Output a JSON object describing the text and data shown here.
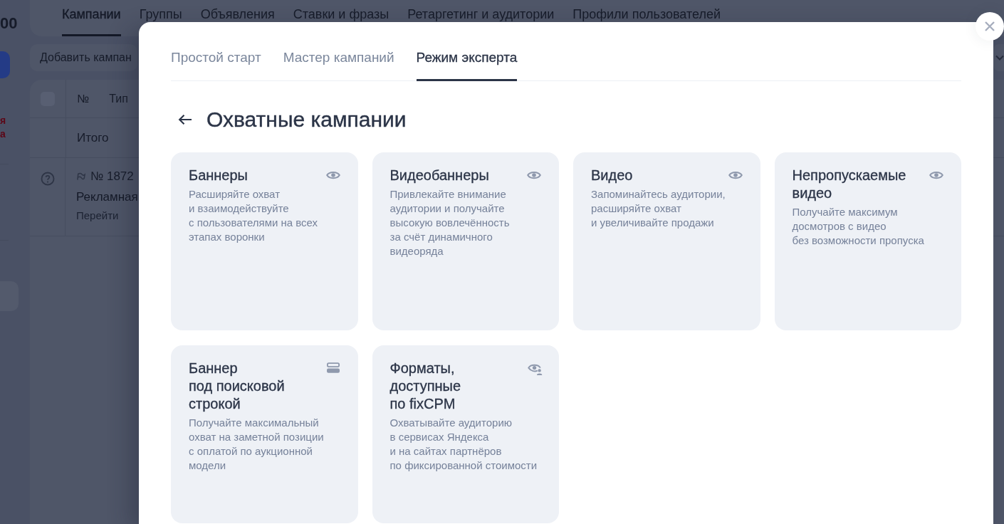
{
  "background_page": {
    "balance": "00",
    "notices": [
      "я",
      "а"
    ],
    "tabs": [
      {
        "label": "Кампании",
        "selected": true
      },
      {
        "label": "Группы",
        "selected": false
      },
      {
        "label": "Объявления",
        "selected": false
      },
      {
        "label": "Ставки и фразы",
        "selected": false
      },
      {
        "label": "Ретаргетинг и аудитории",
        "selected": false
      },
      {
        "label": "Профили пользователей",
        "selected": false
      }
    ],
    "add_button": "Добавить кампан",
    "table": {
      "select_all": {
        "checked": false
      },
      "columns": [
        "№",
        "Тип"
      ],
      "total_label": "Итого",
      "rows": [
        {
          "number": "№ 1872",
          "name": "Рекламная",
          "link": "Перейти"
        }
      ]
    }
  },
  "modal": {
    "tabs": [
      {
        "label": "Простой старт",
        "selected": false
      },
      {
        "label": "Мастер кампаний",
        "selected": false
      },
      {
        "label": "Режим эксперта",
        "selected": true
      }
    ],
    "title": "Охватные кампании",
    "cards": [
      {
        "kind": "format",
        "title": "Баннеры",
        "description": "Расширяйте охват\nи взаимодействуйте\nс пользователями на всех\nэтапах воронки"
      },
      {
        "kind": "format",
        "title": "Видеобаннеры",
        "description": "Привлекайте внимание\nаудитории и получайте\nвысокую вовлечённость\nза счёт динамичного\nвидеоряда"
      },
      {
        "kind": "format",
        "title": "Видео",
        "description": "Запоминайтесь аудитории,\nрасширяйте охват\nи увеличивайте продажи"
      },
      {
        "kind": "format",
        "title": "Непропускаемые\nвидео",
        "description": "Получайте максимум\nдосмотров с видео\nбез возможности пропуска"
      },
      {
        "kind": "searchbar",
        "title": "Баннер\nпод поисковой\nстрокой",
        "description": "Получайте максимальный\nохват на заметной позиции\nс оплатой по аукционной\nмодели"
      },
      {
        "kind": "fixcpm",
        "title": "Форматы,\nдоступные\nпо fixCPM",
        "description": "Охватывайте аудиторию\nв сервисах Яндекса\nи на сайтах партнёров\nпо фиксированной стоимости"
      }
    ]
  }
}
